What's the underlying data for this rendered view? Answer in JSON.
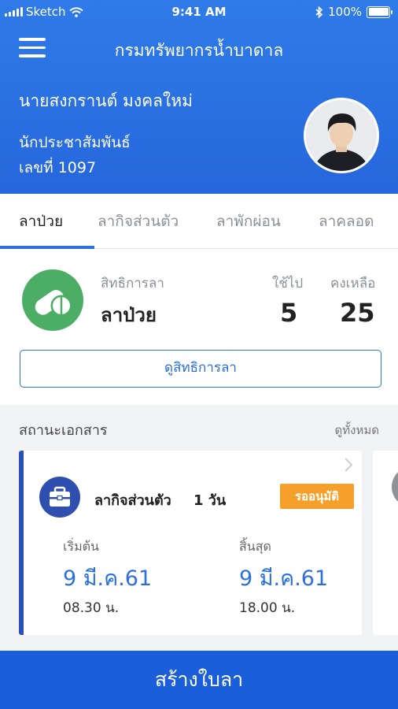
{
  "status_bar": {
    "carrier": "Sketch",
    "time": "9:41 AM",
    "battery": "100%"
  },
  "header": {
    "title": "กรมทรัพยากรน้ำบาดาล",
    "user_name": "นายสงกรานต์ มงคลใหม่",
    "position": "นักประชาสัมพันธ์",
    "employee_id": "เลขที่ 1097"
  },
  "tabs": [
    {
      "label": "ลาป่วย",
      "active": true
    },
    {
      "label": "ลากิจส่วนตัว",
      "active": false
    },
    {
      "label": "ลาพักผ่อน",
      "active": false
    },
    {
      "label": "ลาคลอด",
      "active": false
    }
  ],
  "summary": {
    "right_label": "สิทธิการลา",
    "leave_type": "ลาป่วย",
    "used_label": "ใช้ไป",
    "used_value": "5",
    "remaining_label": "คงเหลือ",
    "remaining_value": "25",
    "view_rights_label": "ดูสิทธิการลา",
    "icon": "pill-icon"
  },
  "documents": {
    "section_title": "สถานะเอกสาร",
    "see_all_label": "ดูทั้งหมด",
    "cards": [
      {
        "icon": "briefcase-icon",
        "leave_type": "ลากิจส่วนตัว",
        "days": "1 วัน",
        "status": "รออนุมัติ",
        "start_label": "เริ่มต้น",
        "start_date": "9 มี.ค.61",
        "start_time": "08.30 น.",
        "end_label": "สิ้นสุด",
        "end_date": "9 มี.ค.61",
        "end_time": "18.00 น."
      }
    ]
  },
  "create_button_label": "สร้างใบลา",
  "colors": {
    "header_blue": "#2b6fe0",
    "button_blue": "#1a5fd9",
    "pill_green": "#4cae65",
    "briefcase_navy": "#2e4faf",
    "pending_orange": "#f5a02a"
  }
}
